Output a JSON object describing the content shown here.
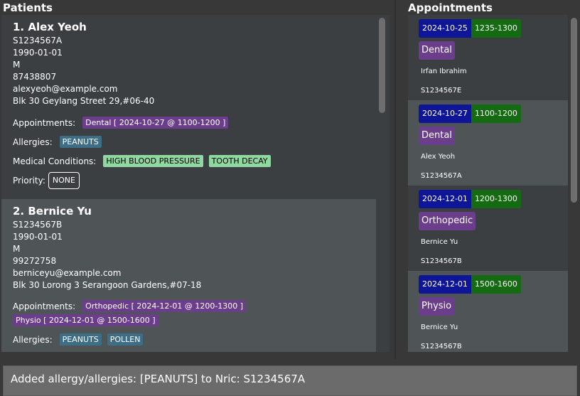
{
  "patients_title": "Patients",
  "appointments_title": "Appointments",
  "labels": {
    "appointments": "Appointments:",
    "allergies": "Allergies:",
    "medical_conditions": "Medical Conditions:",
    "priority": "Priority:"
  },
  "patients": [
    {
      "name": "1. Alex Yeoh",
      "nric": "S1234567A",
      "dob": "1990-01-01",
      "sex": "M",
      "phone": "87438807",
      "email": "alexyeoh@example.com",
      "address": "Blk 30 Geylang Street 29,#06-40",
      "appointments": [
        "Dental [ 2024-10-27 @ 1100-1200 ]"
      ],
      "allergies": [
        "PEANUTS"
      ],
      "conditions": [
        "HIGH BLOOD PRESSURE",
        "TOOTH DECAY"
      ],
      "priority": "NONE"
    },
    {
      "name": "2. Bernice Yu",
      "nric": "S1234567B",
      "dob": "1990-01-01",
      "sex": "M",
      "phone": "99272758",
      "email": "berniceyu@example.com",
      "address": "Blk 30 Lorong 3 Serangoon Gardens,#07-18",
      "appointments": [
        "Orthopedic [ 2024-12-01 @ 1200-1300 ]",
        "Physio [ 2024-12-01 @ 1500-1600 ]"
      ],
      "allergies": [
        "PEANUTS",
        "POLLEN"
      ]
    }
  ],
  "appointments": [
    {
      "date": "2024-10-25",
      "time": "1235-1300",
      "type": "Dental",
      "name": "Irfan Ibrahim",
      "nric": "S1234567E"
    },
    {
      "date": "2024-10-27",
      "time": "1100-1200",
      "type": "Dental",
      "name": "Alex Yeoh",
      "nric": "S1234567A"
    },
    {
      "date": "2024-12-01",
      "time": "1200-1300",
      "type": "Orthopedic",
      "name": "Bernice Yu",
      "nric": "S1234567B"
    },
    {
      "date": "2024-12-01",
      "time": "1500-1600",
      "type": "Physio",
      "name": "Bernice Yu",
      "nric": "S1234567B"
    }
  ],
  "result_message": "Added allergy/allergies: [PEANUTS] to Nric: S1234567A",
  "colors": {
    "background": "#383838",
    "card_dark": "#3c3f41",
    "card_light": "#4f5557",
    "appointment_tag": "#6b3e8c",
    "allergy_tag": "#3e6e86",
    "condition_tag": "#8fd8a0",
    "date_badge": "#0e1596",
    "time_badge": "#156b12"
  }
}
